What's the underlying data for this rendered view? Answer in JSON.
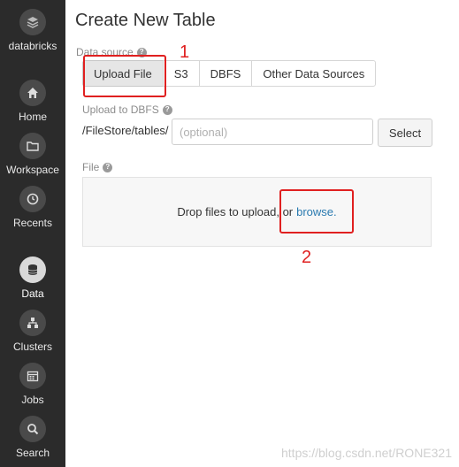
{
  "sidebar": {
    "logo_label": "databricks",
    "items": [
      {
        "label": "Home",
        "icon": "home-icon"
      },
      {
        "label": "Workspace",
        "icon": "folder-icon"
      },
      {
        "label": "Recents",
        "icon": "clock-icon"
      },
      {
        "label": "Data",
        "icon": "database-icon",
        "active": true
      },
      {
        "label": "Clusters",
        "icon": "cluster-icon"
      },
      {
        "label": "Jobs",
        "icon": "calendar-icon"
      },
      {
        "label": "Search",
        "icon": "search-icon"
      }
    ]
  },
  "main": {
    "title": "Create New Table",
    "data_source_label": "Data source",
    "tabs": [
      {
        "label": "Upload File",
        "active": true
      },
      {
        "label": "S3"
      },
      {
        "label": "DBFS"
      },
      {
        "label": "Other Data Sources"
      }
    ],
    "upload_label": "Upload to DBFS",
    "path_prefix": "/FileStore/tables/",
    "path_placeholder": "(optional)",
    "select_label": "Select",
    "file_label": "File",
    "drop_text": "Drop files to upload, or",
    "browse_text": "browse."
  },
  "annotations": {
    "num1": "1",
    "num2": "2",
    "color": "#e02020"
  },
  "watermark": "https://blog.csdn.net/RONE321"
}
